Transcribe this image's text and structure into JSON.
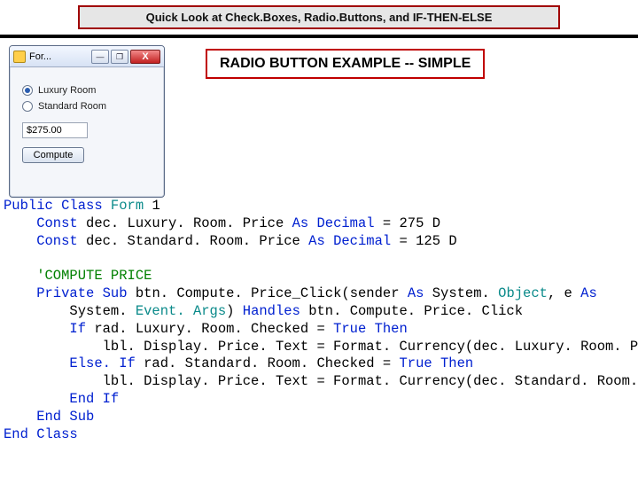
{
  "banner": {
    "text": "Quick Look at Check.Boxes, Radio.Buttons, and IF-THEN-ELSE"
  },
  "heading": {
    "text": "RADIO BUTTON EXAMPLE -- SIMPLE"
  },
  "window": {
    "title": "For...",
    "minimize": "—",
    "maximize": "❐",
    "close": "X",
    "radio1": "Luxury Room",
    "radio2": "Standard Room",
    "price": "$275.00",
    "compute": "Compute"
  },
  "code": {
    "l01a": "Public",
    "l01b": " Class",
    "l01c": " Form",
    "l01d": " 1",
    "l02a": "    Const",
    "l02b": " dec. Luxury. Room. Price ",
    "l02c": "As",
    "l02d": " Decimal",
    "l02e": " = 275 D",
    "l03a": "    Const",
    "l03b": " dec. Standard. Room. Price ",
    "l03c": "As",
    "l03d": " Decimal",
    "l03e": " = 125 D",
    "blank1": " ",
    "l05": "    'COMPUTE PRICE",
    "l06a": "    Private",
    "l06b": " Sub",
    "l06c": " btn. Compute. Price_Click(sender ",
    "l06d": "As",
    "l06e": " System. ",
    "l06f": "Object",
    "l06g": ", e ",
    "l06h": "As",
    "l07a": "        System. ",
    "l07b": "Event. Args",
    "l07c": ") ",
    "l07d": "Handles",
    "l07e": " btn. Compute. Price. Click",
    "l08a": "        If",
    "l08b": " rad. Luxury. Room. Checked = ",
    "l08c": "True",
    "l08d": " Then",
    "l09": "            lbl. Display. Price. Text = Format. Currency(dec. Luxury. Room. Price)",
    "l10a": "        Else. If",
    "l10b": " rad. Standard. Room. Checked = ",
    "l10c": "True",
    "l10d": " Then",
    "l11": "            lbl. Display. Price. Text = Format. Currency(dec. Standard. Room. Price)",
    "l12": "        End",
    "l12b": " If",
    "l13": "    End",
    "l13b": " Sub",
    "l14": "End",
    "l14b": " Class"
  }
}
